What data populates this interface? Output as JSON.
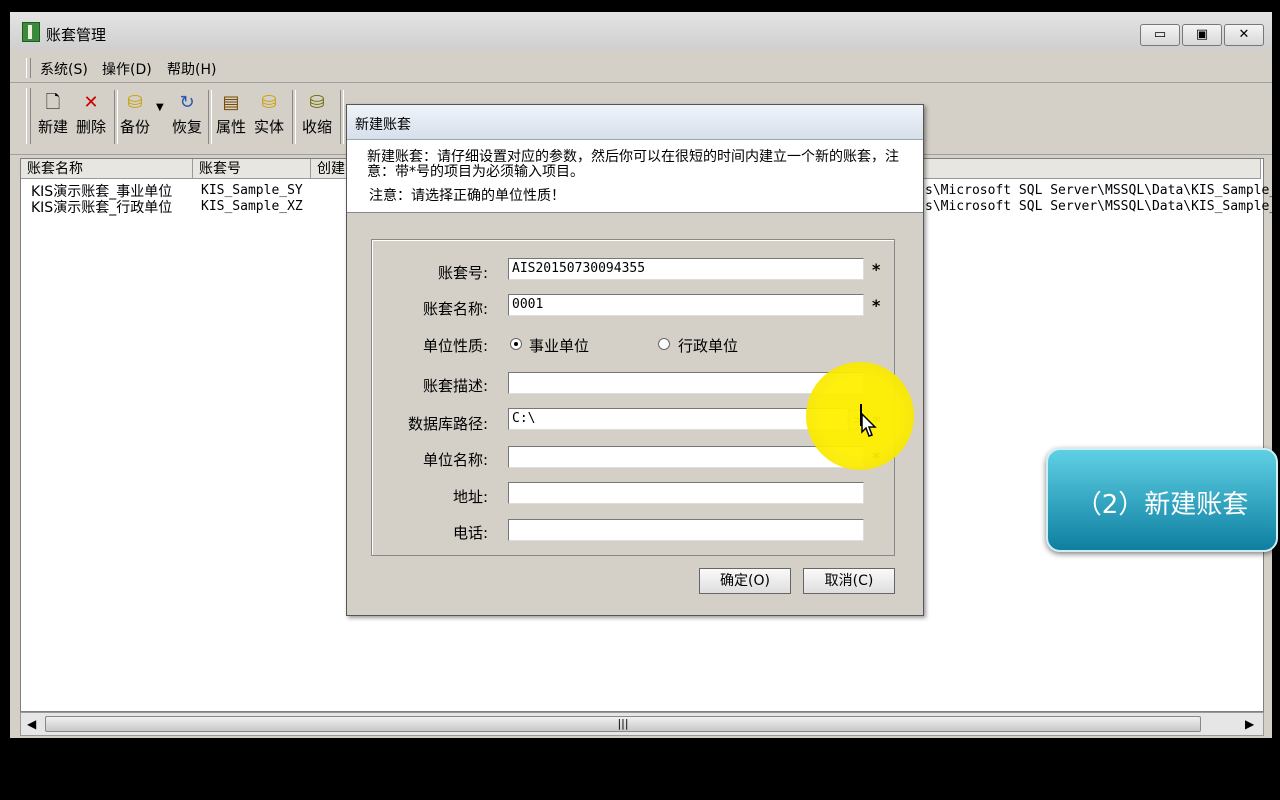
{
  "window": {
    "title": "账套管理",
    "controls": {
      "minimize": "▭",
      "maximize": "▣",
      "close": "✕"
    }
  },
  "menu": [
    "系统(S)",
    "操作(D)",
    "帮助(H)"
  ],
  "toolbar": [
    {
      "label": "新建",
      "icon": "🗋"
    },
    {
      "label": "删除",
      "icon": "✕"
    },
    {
      "label": "备份",
      "icon": "⛁"
    },
    {
      "label": "恢复",
      "icon": "↻"
    },
    {
      "label": "属性",
      "icon": "▤"
    },
    {
      "label": "实体",
      "icon": "⛁"
    },
    {
      "label": "收缩",
      "icon": "⛁"
    }
  ],
  "list": {
    "columns": [
      "账套名称",
      "账套号",
      "创建"
    ],
    "rows": [
      {
        "name": "KIS演示账套_事业单位",
        "code": "KIS_Sample_SY",
        "path": "s\\Microsoft SQL Server\\MSSQL\\Data\\KIS_Sample_"
      },
      {
        "name": "KIS演示账套_行政单位",
        "code": "KIS_Sample_XZ",
        "path": "s\\Microsoft SQL Server\\MSSQL\\Data\\KIS_Sample_"
      }
    ],
    "scroll_thumb": "|||"
  },
  "dialog": {
    "title": "新建账套",
    "header_line1": "新建账套：请仔细设置对应的参数，然后你可以在很短的时间内建立一个新的账套，注意：带*号的项目为必须输入项目。",
    "header_line2": "注意：请选择正确的单位性质！",
    "fields": {
      "code_label": "账套号:",
      "code_value": "AIS20150730094355",
      "name_label": "账套名称:",
      "name_value": "0001",
      "type_label": "单位性质:",
      "type_option1": "事业单位",
      "type_option2": "行政单位",
      "desc_label": "账套描述:",
      "desc_value": "",
      "dbpath_label": "数据库路径:",
      "dbpath_value": "C:\\",
      "browse": ">",
      "unit_label": "单位名称:",
      "unit_value": "",
      "address_label": "地址:",
      "address_value": "",
      "phone_label": "电话:",
      "phone_value": "",
      "required_mark": "*"
    },
    "ok": "确定(O)",
    "cancel": "取消(C)"
  },
  "badge": "（2）新建账套",
  "colors": {
    "highlight": "#f5e400",
    "badge": "#1a9cbc"
  }
}
